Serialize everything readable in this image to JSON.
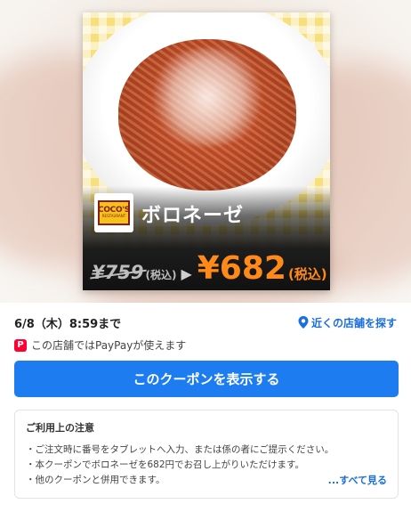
{
  "product": {
    "name": "ボロネーゼ",
    "brand_logo": {
      "main": "COCO'S",
      "sub": "RESTAURANT"
    },
    "old_price": "¥759",
    "old_price_tax": "(税込)",
    "new_price": "¥682",
    "new_price_tax": "(税込)"
  },
  "coupon": {
    "expiry": "6/8（木）8:59まで",
    "nearby_stores": "近くの店舗を探す",
    "paypay_notice": "この店舗ではPayPayが使えます",
    "paypay_icon_letter": "P",
    "show_button": "このクーポンを表示する"
  },
  "notes": {
    "title": "ご利用上の注意",
    "items": [
      "・ご注文時に番号をタブレットへ入力、または係の者にご提示ください。",
      "・本クーポンでボロネーゼを682円でお召し上がりいただけます。",
      "・他のクーポンと併用できます。"
    ],
    "see_all": "...すべて見る"
  },
  "colors": {
    "accent": "#1c7cf0",
    "link": "#1a6ee0",
    "price": "#ff8a1a",
    "paypay": "#ff0033"
  },
  "icons": [
    "location-pin-icon",
    "paypay-icon",
    "arrow-right-icon"
  ]
}
